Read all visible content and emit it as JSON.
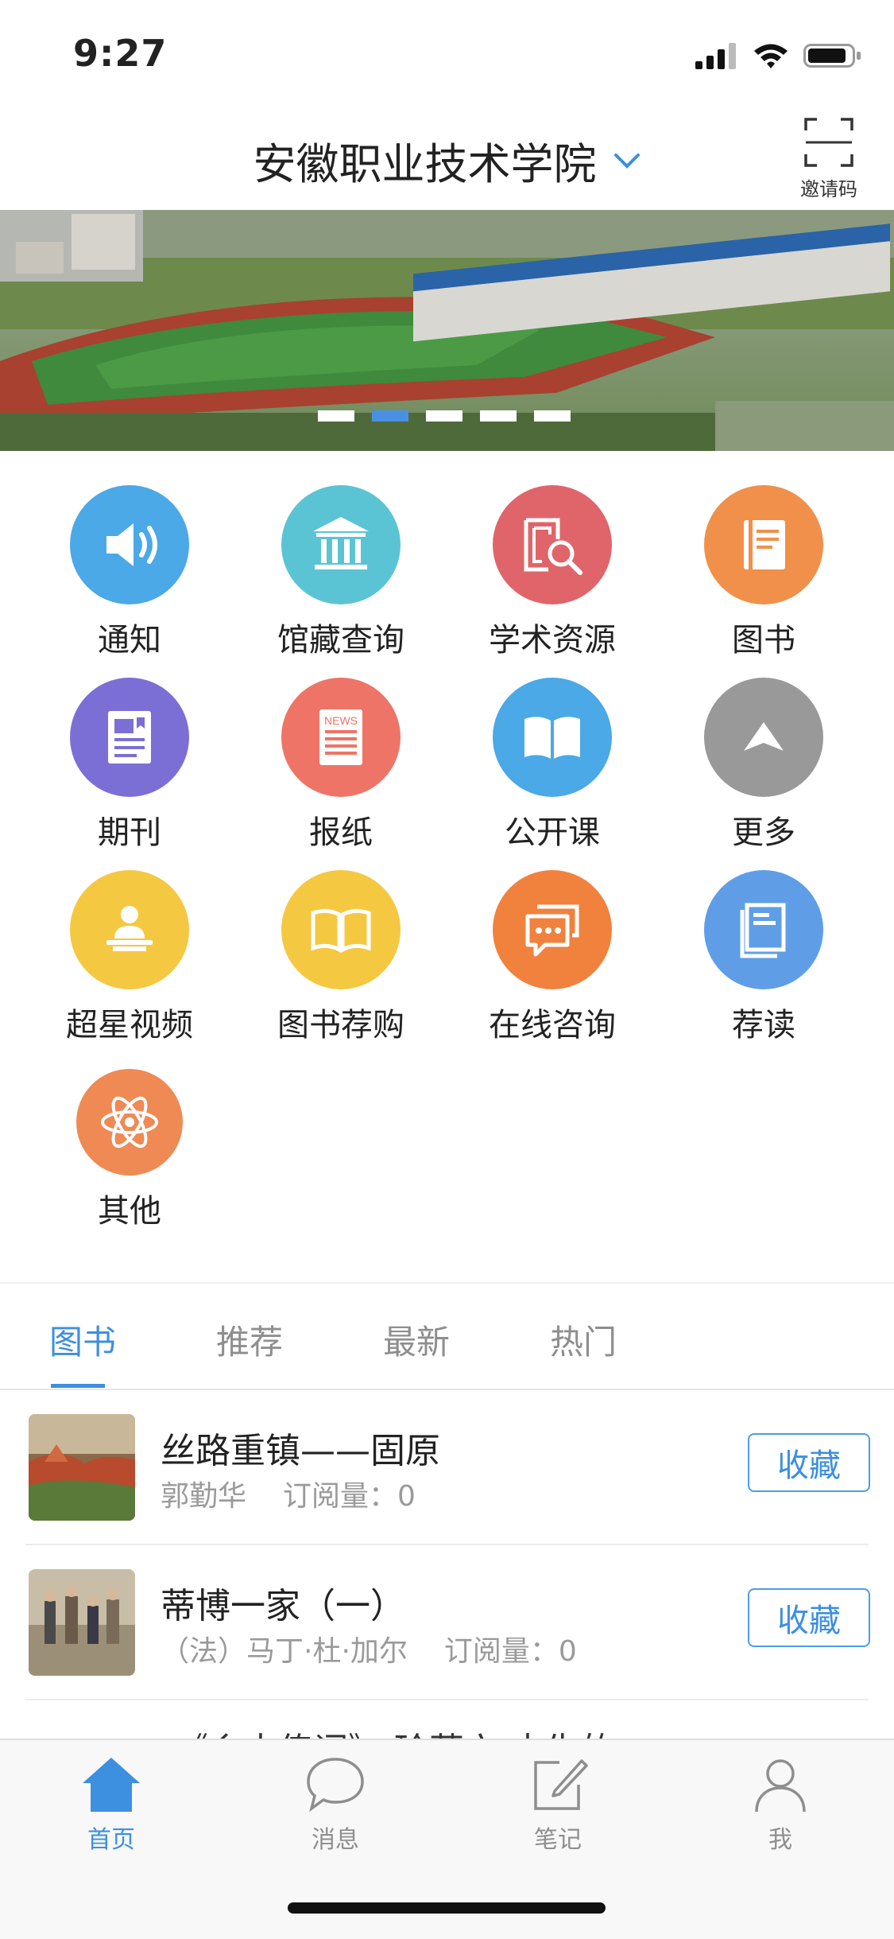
{
  "status_bar": {
    "time": "9:27"
  },
  "header": {
    "title": "安徽职业技术学院",
    "scan_label": "邀请码"
  },
  "banner": {
    "slide_count": 5,
    "active_slide": 2
  },
  "grid": [
    {
      "label": "通知",
      "icon": "speaker-icon",
      "color": "#4aa9e6"
    },
    {
      "label": "馆藏查询",
      "icon": "library-building-icon",
      "color": "#5bc4d4"
    },
    {
      "label": "学术资源",
      "icon": "resource-search-icon",
      "color": "#e0656a"
    },
    {
      "label": "图书",
      "icon": "book-icon",
      "color": "#f0904a"
    },
    {
      "label": "期刊",
      "icon": "journal-icon",
      "color": "#7b6fd6"
    },
    {
      "label": "报纸",
      "icon": "newspaper-icon",
      "color": "#ee7467"
    },
    {
      "label": "公开课",
      "icon": "open-book-icon",
      "color": "#4aa9e6"
    },
    {
      "label": "更多",
      "icon": "arrow-up-icon",
      "color": "#999999"
    },
    {
      "label": "超星视频",
      "icon": "lecturer-icon",
      "color": "#f5c842"
    },
    {
      "label": "图书荐购",
      "icon": "open-book-icon",
      "color": "#f5c842"
    },
    {
      "label": "在线咨询",
      "icon": "chat-icon",
      "color": "#f0823e"
    },
    {
      "label": "荐读",
      "icon": "reading-icon",
      "color": "#5f9ee6"
    },
    {
      "label": "其他",
      "icon": "atom-icon",
      "color": "#ef8a55"
    }
  ],
  "newspaper_badge": "NEWS",
  "tabs": [
    {
      "label": "图书",
      "active": true
    },
    {
      "label": "推荐",
      "active": false
    },
    {
      "label": "最新",
      "active": false
    },
    {
      "label": "热门",
      "active": false
    }
  ],
  "books": [
    {
      "title": "丝路重镇——固原",
      "author": "郭勤华",
      "subs_label": "订阅量：",
      "subs": "0",
      "button": "收藏"
    },
    {
      "title": "蒂博一家（一）",
      "author": "（法）马丁·杜·加尔",
      "subs_label": "订阅量：",
      "subs": "0",
      "button": "收藏"
    }
  ],
  "partial_book_title": "《乡土传词》 玲草六 去失的",
  "tabbar": [
    {
      "label": "首页",
      "icon": "home-icon",
      "active": true
    },
    {
      "label": "消息",
      "icon": "message-icon",
      "active": false
    },
    {
      "label": "笔记",
      "icon": "note-edit-icon",
      "active": false
    },
    {
      "label": "我",
      "icon": "user-icon",
      "active": false
    }
  ],
  "colors": {
    "accent": "#3d8fe0"
  }
}
